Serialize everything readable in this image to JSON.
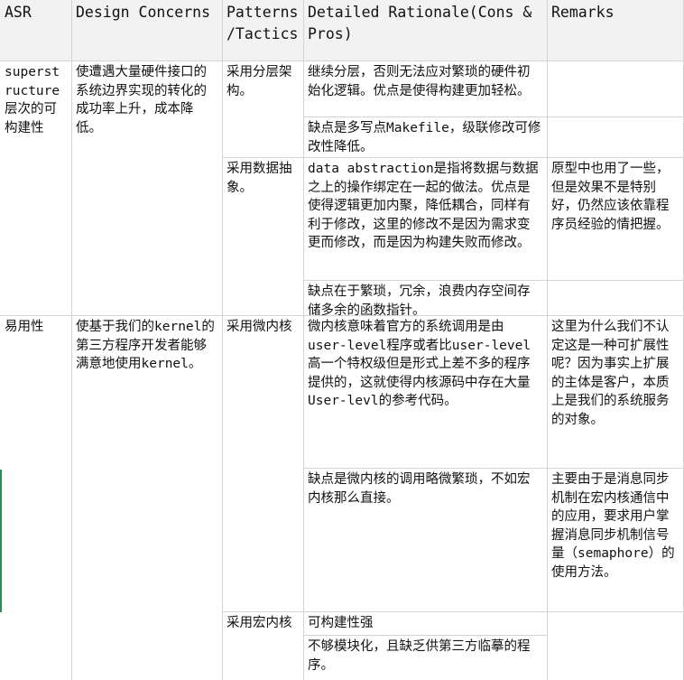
{
  "headers": {
    "asr": "ASR",
    "design_concerns": "Design Concerns",
    "patterns": "Patterns /Tactics",
    "rationale": "Detailed Rationale(Cons & Pros)",
    "remarks": "Remarks"
  },
  "rows": {
    "r1": {
      "asr": "superstructure层次的可构建性",
      "concern": "使遭遇大量硬件接口的系统边界实现的转化的成功率上升，成本降低。",
      "p1": {
        "pattern": "采用分层架构。",
        "pro": "继续分层，否则无法应对繁琐的硬件初始化逻辑。优点是使得构建更加轻松。",
        "con": "缺点是多写点Makefile，级联修改可修改性降低。"
      },
      "p2": {
        "pattern": "采用数据抽象。",
        "pro": "data abstraction是指将数据与数据之上的操作绑定在一起的做法。优点是使得逻辑更加内聚，降低耦合，同样有利于修改，这里的修改不是因为需求变更而修改，而是因为构建失败而修改。",
        "remark": "原型中也用了一些，但是效果不是特别好，仍然应该依靠程序员经验的情把握。",
        "con": "缺点在于繁琐，冗余，浪费内存空间存储多余的函数指针。"
      }
    },
    "r2": {
      "asr": "易用性",
      "concern": "使基于我们的kernel的第三方程序开发者能够满意地使用kernel。",
      "p1": {
        "pattern": "采用微内核",
        "pro": "微内核意味着官方的系统调用是由user-level程序或者比user-level高一个特权级但是形式上差不多的程序提供的，这就使得内核源码中存在大量User-levl的参考代码。",
        "remark1": "这里为什么我们不认定这是一种可扩展性呢？因为事实上扩展的主体是客户，本质上是我们的系统服务的对象。",
        "con": "缺点是微内核的调用略微繁琐，不如宏内核那么直接。",
        "remark2": "主要由于是消息同步机制在宏内核通信中的应用，要求用户掌握消息同步机制信号量（semaphore）的使用方法。"
      },
      "p2": {
        "pattern": "采用宏内核",
        "pro": "可构建性强",
        "con": "不够模块化，且缺乏供第三方临摹的程序。"
      }
    }
  }
}
